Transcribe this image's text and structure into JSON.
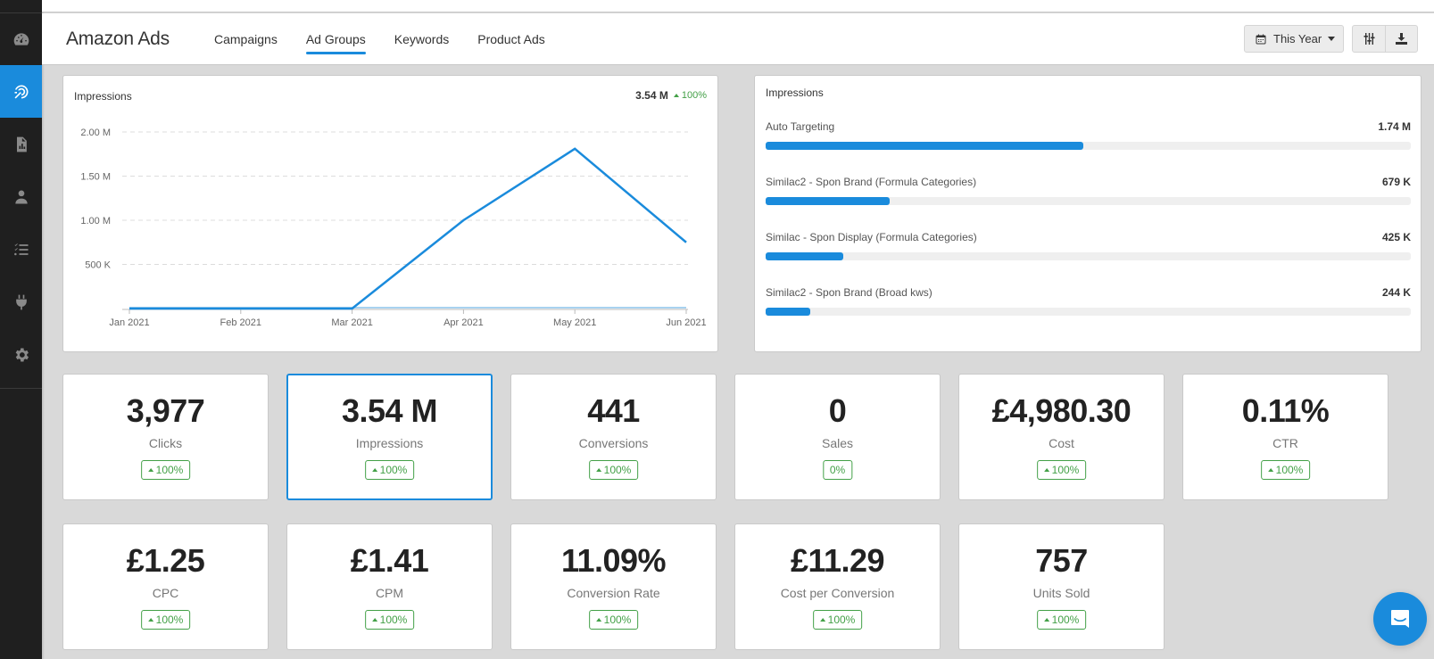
{
  "sidebar": {
    "items": [
      {
        "name": "dashboard",
        "icon": "speedometer-icon",
        "active": false
      },
      {
        "name": "ads",
        "icon": "target-arrow-icon",
        "active": true
      },
      {
        "name": "reports",
        "icon": "report-file-icon",
        "active": false
      },
      {
        "name": "users",
        "icon": "user-icon",
        "active": false
      },
      {
        "name": "tasks",
        "icon": "checklist-icon",
        "active": false
      },
      {
        "name": "integrations",
        "icon": "plug-icon",
        "active": false
      },
      {
        "name": "settings",
        "icon": "gear-icon",
        "active": false
      }
    ]
  },
  "header": {
    "title": "Amazon Ads",
    "tabs": [
      {
        "label": "Campaigns",
        "active": false
      },
      {
        "label": "Ad Groups",
        "active": true
      },
      {
        "label": "Keywords",
        "active": false
      },
      {
        "label": "Product Ads",
        "active": false
      }
    ],
    "date_range": "This Year",
    "date_icon": "calendar-icon",
    "actions": [
      {
        "name": "column-settings",
        "icon": "sliders-icon"
      },
      {
        "name": "download",
        "icon": "download-icon"
      }
    ]
  },
  "line_panel": {
    "title": "Impressions",
    "total": "3.54 M",
    "change": "100%"
  },
  "bars_panel": {
    "title": "Impressions",
    "items": [
      {
        "label": "Auto Targeting",
        "value": "1.74 M",
        "fraction": 0.492
      },
      {
        "label": "Similac2 - Spon Brand (Formula Categories)",
        "value": "679 K",
        "fraction": 0.192
      },
      {
        "label": "Similac - Spon Display (Formula Categories)",
        "value": "425 K",
        "fraction": 0.12
      },
      {
        "label": "Similac2 - Spon Brand (Broad kws)",
        "value": "244 K",
        "fraction": 0.069
      }
    ]
  },
  "chart_data": {
    "type": "line",
    "title": "Impressions",
    "categories": [
      "Jan 2021",
      "Feb 2021",
      "Mar 2021",
      "Apr 2021",
      "May 2021",
      "Jun 2021"
    ],
    "series": [
      {
        "name": "Impressions",
        "color": "#1a8bdc",
        "values": [
          0,
          0,
          0,
          1000000,
          1810000,
          750000
        ]
      }
    ],
    "yticks": [
      {
        "value": 500000,
        "label": "500 K"
      },
      {
        "value": 1000000,
        "label": "1.00 M"
      },
      {
        "value": 1500000,
        "label": "1.50 M"
      },
      {
        "value": 2000000,
        "label": "2.00 M"
      }
    ],
    "ylim": [
      0,
      2000000
    ],
    "xlabel": "",
    "ylabel": "",
    "grid": true,
    "legend": "none"
  },
  "kpis": [
    {
      "value": "3,977",
      "label": "Clicks",
      "change": "100%",
      "up": true,
      "selected": false
    },
    {
      "value": "3.54 M",
      "label": "Impressions",
      "change": "100%",
      "up": true,
      "selected": true
    },
    {
      "value": "441",
      "label": "Conversions",
      "change": "100%",
      "up": true,
      "selected": false
    },
    {
      "value": "0",
      "label": "Sales",
      "change": "0%",
      "up": false,
      "selected": false
    },
    {
      "value": "£4,980.30",
      "label": "Cost",
      "change": "100%",
      "up": true,
      "selected": false
    },
    {
      "value": "0.11%",
      "label": "CTR",
      "change": "100%",
      "up": true,
      "selected": false
    },
    {
      "value": "£1.25",
      "label": "CPC",
      "change": "100%",
      "up": true,
      "selected": false
    },
    {
      "value": "£1.41",
      "label": "CPM",
      "change": "100%",
      "up": true,
      "selected": false
    },
    {
      "value": "11.09%",
      "label": "Conversion Rate",
      "change": "100%",
      "up": true,
      "selected": false
    },
    {
      "value": "£11.29",
      "label": "Cost per Conversion",
      "change": "100%",
      "up": true,
      "selected": false
    },
    {
      "value": "757",
      "label": "Units Sold",
      "change": "100%",
      "up": true,
      "selected": false
    }
  ],
  "chat": {
    "icon": "chat-bubble-icon"
  },
  "colors": {
    "accent": "#1a8bdc",
    "positive": "#43a047",
    "sidebar": "#1f1f1f",
    "background": "#d9d9d9"
  }
}
